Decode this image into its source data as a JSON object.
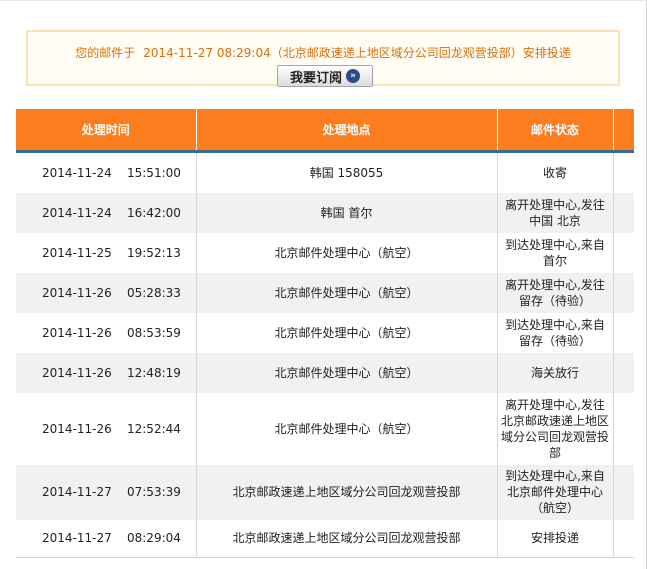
{
  "notice": {
    "prefix": "您的邮件于",
    "datetime": "2014-11-27 08:29:04",
    "location": "（北京邮政速递上地区域分公司回龙观营投部）",
    "status": "安排投递"
  },
  "subscribe_button": {
    "label": "我要订阅"
  },
  "table": {
    "headers": [
      "处理时间",
      "处理地点",
      "邮件状态"
    ],
    "rows": [
      {
        "time": "2014-11-24    15:51:00",
        "place": "韩国 158055",
        "status": "收寄"
      },
      {
        "time": "2014-11-24    16:42:00",
        "place": "韩国 首尔",
        "status": "离开处理中心,发往中国 北京"
      },
      {
        "time": "2014-11-25    19:52:13",
        "place": "北京邮件处理中心（航空）",
        "status": "到达处理中心,来自首尔"
      },
      {
        "time": "2014-11-26    05:28:33",
        "place": "北京邮件处理中心（航空）",
        "status": "离开处理中心,发往留存（待验）"
      },
      {
        "time": "2014-11-26    08:53:59",
        "place": "北京邮件处理中心（航空）",
        "status": "到达处理中心,来自留存（待验）"
      },
      {
        "time": "2014-11-26    12:48:19",
        "place": "北京邮件处理中心（航空）",
        "status": "海关放行"
      },
      {
        "time": "2014-11-26    12:52:44",
        "place": "北京邮件处理中心（航空）",
        "status": "离开处理中心,发往北京邮政速递上地区域分公司回龙观营投部"
      },
      {
        "time": "2014-11-27    07:53:39",
        "place": "北京邮政速递上地区域分公司回龙观营投部",
        "status": "到达处理中心,来自北京邮件处理中心（航空）"
      },
      {
        "time": "2014-11-27    08:29:04",
        "place": "北京邮政速递上地区域分公司回龙观营投部",
        "status": "安排投递"
      }
    ]
  },
  "colors": {
    "header_bg": "#fc7d1e",
    "header_underline": "#3a6a9a",
    "notice_text": "#d96f0b",
    "notice_border": "#fbe2b6"
  },
  "icons": {
    "subscribe_arrow": "double-chevron-right-icon"
  }
}
